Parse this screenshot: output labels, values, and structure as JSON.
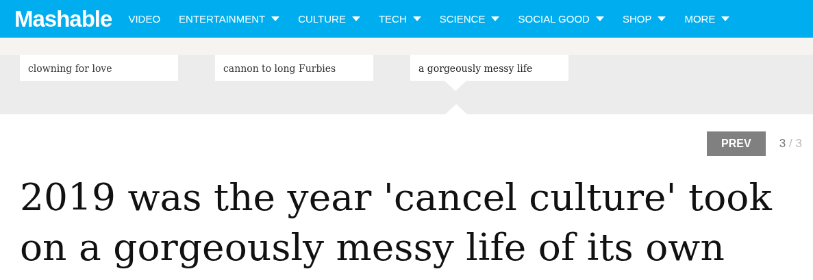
{
  "logo": "Mashable",
  "nav": [
    {
      "label": "VIDEO",
      "dropdown": false
    },
    {
      "label": "ENTERTAINMENT",
      "dropdown": true
    },
    {
      "label": "CULTURE",
      "dropdown": true
    },
    {
      "label": "TECH",
      "dropdown": true
    },
    {
      "label": "SCIENCE",
      "dropdown": true
    },
    {
      "label": "SOCIAL GOOD",
      "dropdown": true
    },
    {
      "label": "SHOP",
      "dropdown": true
    },
    {
      "label": "MORE",
      "dropdown": true
    }
  ],
  "cards": [
    {
      "text": "clowning for love",
      "selected": false
    },
    {
      "text": "cannon to long Furbies",
      "selected": false
    },
    {
      "text": "a gorgeously messy life",
      "selected": true
    }
  ],
  "pager": {
    "button": "PREV",
    "current": "3",
    "separator": "/",
    "total": "3"
  },
  "headline": "2019 was the year 'cancel culture' took on a gorgeously messy life of its own"
}
